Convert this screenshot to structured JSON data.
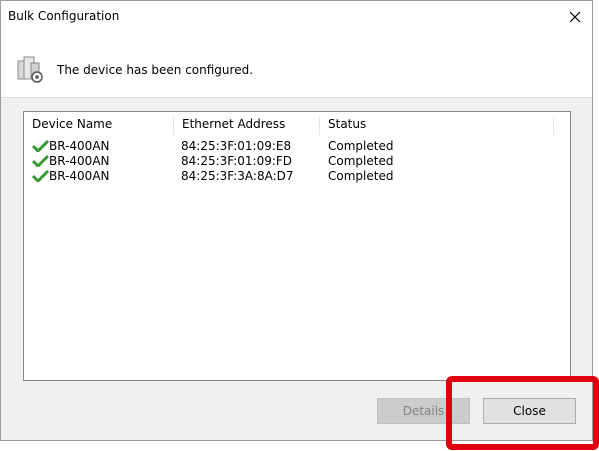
{
  "window": {
    "title": "Bulk Configuration",
    "close_label": "×"
  },
  "header": {
    "icon": "server-gear-icon",
    "message": "The device has been configured."
  },
  "table": {
    "columns": [
      "Device Name",
      "Ethernet Address",
      "Status"
    ],
    "rows": [
      {
        "icon": "check-icon",
        "name": "BR-400AN",
        "ethernet": "84:25:3F:01:09:E8",
        "status": "Completed"
      },
      {
        "icon": "check-icon",
        "name": "BR-400AN",
        "ethernet": "84:25:3F:01:09:FD",
        "status": "Completed"
      },
      {
        "icon": "check-icon",
        "name": "BR-400AN",
        "ethernet": "84:25:3F:3A:8A:D7",
        "status": "Completed"
      }
    ]
  },
  "buttons": {
    "details": {
      "label": "Details",
      "enabled": false
    },
    "close": {
      "label": "Close",
      "enabled": true
    }
  },
  "colors": {
    "check": "#3a9b35",
    "highlight": "#e0000f",
    "dialog_bg": "#f0f0f0"
  }
}
